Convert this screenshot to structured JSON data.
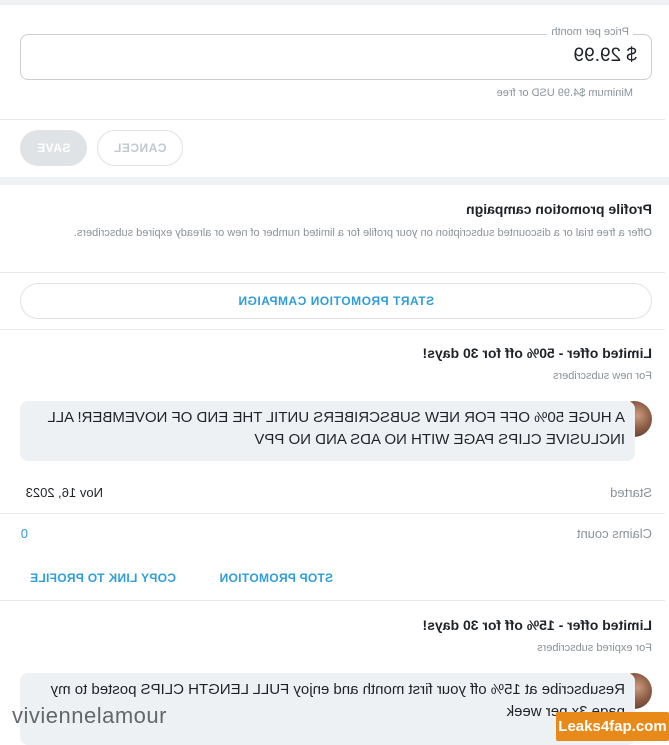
{
  "price": {
    "label": "Price per month",
    "value": "$ 29.99",
    "hint": "Minimum $4.99 USD or free"
  },
  "actions": {
    "save_label": "SAVE",
    "cancel_label": "CANCEL"
  },
  "promotion": {
    "title": "Profile promotion campaign",
    "description": "Offer a free trial or a discounted subscription on your profile for a limited number of new or already expired subscribers.",
    "start_label": "START PROMOTION CAMPAIGN"
  },
  "offers": [
    {
      "title": "Limited offer - 50% off for 30 days!",
      "audience": "For new subscribers",
      "message": "A HUGE 50% OFF FOR NEW SUBSCRIBERS UNTIL THE END OF NOVEMBER! ALL INCLUSIVE CLIPS PAGE WITH NO ADS AND NO PPV",
      "started_label": "Started",
      "started_value": "Nov 16, 2023",
      "claims_label": "Claims count",
      "claims_value": "0",
      "stop_label": "STOP PROMOTION",
      "copy_label": "COPY LINK TO PROFILE"
    },
    {
      "title": "Limited offer - 15% off for 30 days!",
      "audience": "For expired subscribers",
      "message": "Resubscribe at 15% off your first month and enjoy FULL LENGTH CLIPS posted to my page 3x per week"
    }
  ],
  "watermark": {
    "text": "viviennelamour",
    "badge": "Leaks4fap.com"
  }
}
